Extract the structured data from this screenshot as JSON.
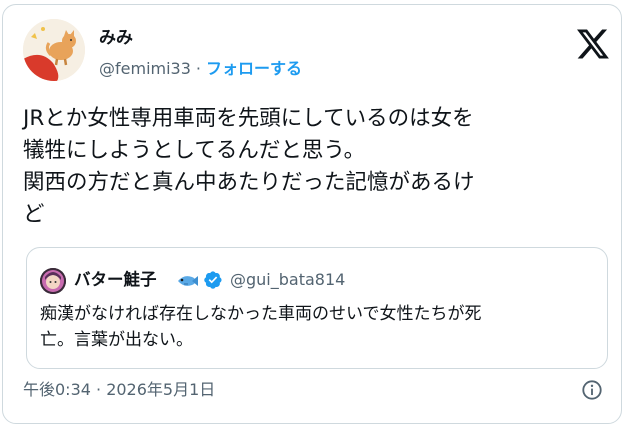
{
  "author": {
    "name": "みみ",
    "handle": "@femimi33",
    "separator": "·",
    "follow_label": "フォローする"
  },
  "post": {
    "lines": [
      "JRとか女性専用車両を先頭にしているのは女を",
      "犠牲にしようとしてるんだと思う。",
      "関西の方だと真ん中あたりだった記憶があるけ",
      "ど"
    ],
    "timestamp": "午後0:34 · 2026年5月1日"
  },
  "quoted_post": {
    "name": "バター鮭子",
    "handle": "@gui_bata814",
    "lines": [
      "痴漢がなければ存在しなかった車両のせいで女性たちが死",
      "亡。言葉が出ない。"
    ]
  },
  "icons": {
    "brand": "x-logo-icon",
    "name_emoji": "fish-icon",
    "verified": "verified-badge-icon",
    "info": "info-icon"
  },
  "colors": {
    "accent": "#1d9bf0",
    "text": "#0f1419",
    "secondary_text": "#536471",
    "border": "#cfd9de"
  }
}
